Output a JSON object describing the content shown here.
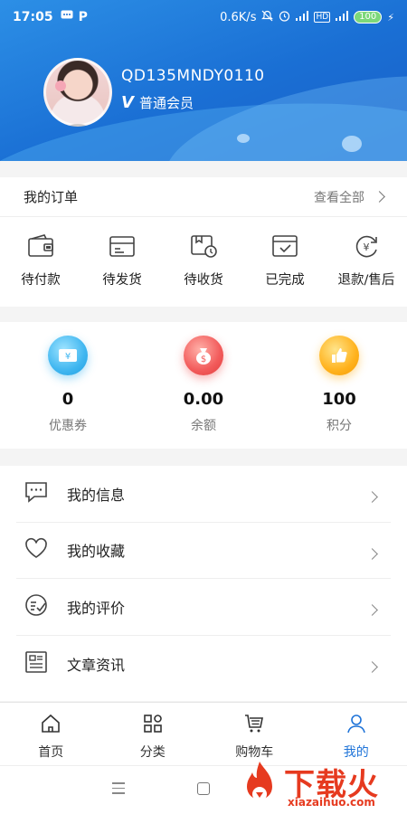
{
  "status_bar": {
    "time": "17:05",
    "net_speed": "0.6K/s",
    "battery": "100"
  },
  "profile": {
    "username": "QD135MNDY0110",
    "member_badge": "V",
    "member_level": "普通会员"
  },
  "orders": {
    "title": "我的订单",
    "view_all": "查看全部",
    "items": [
      {
        "label": "待付款",
        "icon": "wallet-icon"
      },
      {
        "label": "待发货",
        "icon": "box-icon"
      },
      {
        "label": "待收货",
        "icon": "delivery-icon"
      },
      {
        "label": "已完成",
        "icon": "completed-icon"
      },
      {
        "label": "退款/售后",
        "icon": "refund-icon"
      }
    ]
  },
  "assets": [
    {
      "value": "0",
      "label": "优惠券",
      "icon": "coupon-icon",
      "color": "#3fb6f0"
    },
    {
      "value": "0.00",
      "label": "余额",
      "icon": "money-bag-icon",
      "color": "#f25a5a"
    },
    {
      "value": "100",
      "label": "积分",
      "icon": "thumbs-up-icon",
      "color": "#ffb21d"
    }
  ],
  "menu": [
    {
      "label": "我的信息",
      "icon": "message-icon"
    },
    {
      "label": "我的收藏",
      "icon": "heart-icon"
    },
    {
      "label": "我的评价",
      "icon": "review-icon"
    },
    {
      "label": "文章资讯",
      "icon": "article-icon"
    }
  ],
  "tabs": [
    {
      "label": "首页",
      "icon": "home-icon",
      "active": false
    },
    {
      "label": "分类",
      "icon": "category-icon",
      "active": false
    },
    {
      "label": "购物车",
      "icon": "cart-icon",
      "active": false
    },
    {
      "label": "我的",
      "icon": "user-icon",
      "active": true
    }
  ],
  "watermark": {
    "text": "下载火",
    "url": "xiazaihuo.com"
  },
  "colors": {
    "header_blue": "#1a6fd4",
    "active_tab": "#1e73d8"
  }
}
